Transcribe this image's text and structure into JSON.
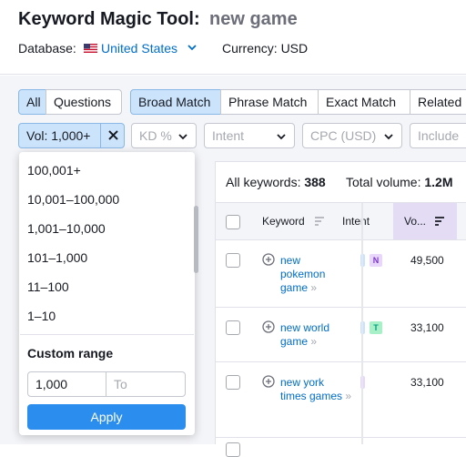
{
  "header": {
    "title": "Keyword Magic Tool:",
    "query": "new game",
    "database_label": "Database:",
    "database_value": "United States",
    "currency": "Currency: USD"
  },
  "tabs": {
    "scope": [
      "All",
      "Questions"
    ],
    "match": [
      "Broad Match",
      "Phrase Match",
      "Exact Match",
      "Related"
    ]
  },
  "filters": {
    "volume": "Vol: 1,000+",
    "kd": "KD %",
    "intent": "Intent",
    "cpc": "CPC (USD)",
    "include": "Include"
  },
  "volume_dropdown": {
    "options": [
      "100,001+",
      "10,001–100,000",
      "1,001–10,000",
      "101–1,000",
      "11–100",
      "1–10"
    ],
    "custom_range_label": "Custom range",
    "from_value": "1,000",
    "to_placeholder": "To",
    "apply_label": "Apply"
  },
  "table": {
    "all_keywords_label": "All keywords:",
    "all_keywords_value": "388",
    "total_volume_label": "Total volume:",
    "total_volume_value": "1.2M",
    "columns": [
      "Keyword",
      "Intent",
      "Vo..."
    ],
    "rows": [
      {
        "keyword": "new pokemon game",
        "intent": "N",
        "volume": "49,500"
      },
      {
        "keyword": "new world game",
        "intent": "T",
        "volume": "33,100"
      },
      {
        "keyword": "new york times games",
        "intent": "",
        "volume": "33,100"
      }
    ]
  },
  "colors": {
    "accent": "#2b8eee",
    "link": "#006dca",
    "selected_tab": "#cbe4fc",
    "intent_navigational": "#e9d7fb",
    "intent_transactional": "#a8f0c7"
  }
}
